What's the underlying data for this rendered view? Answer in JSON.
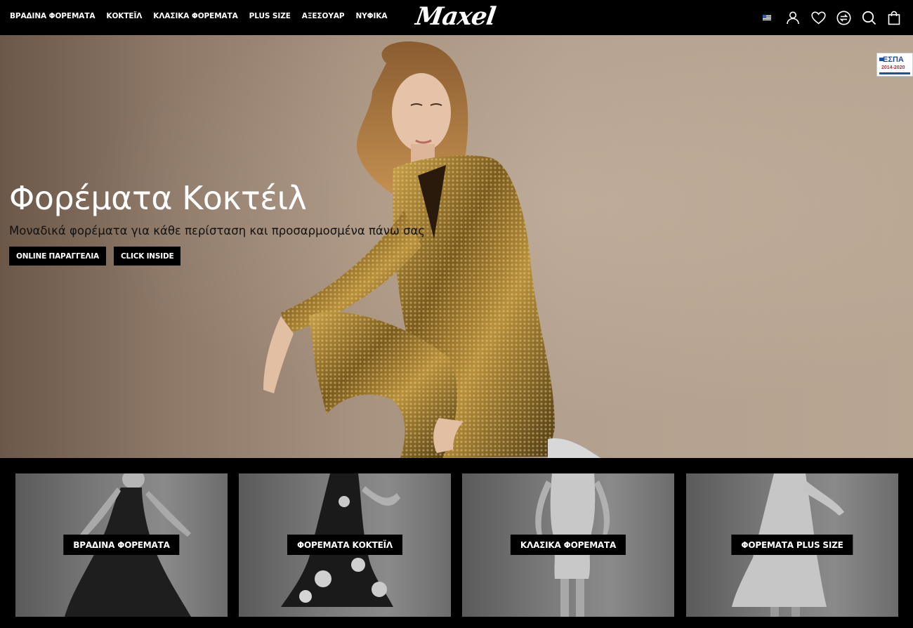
{
  "header": {
    "nav": [
      {
        "label": "ΒΡΑΔΙΝΑ ΦΟΡΕΜΑΤΑ"
      },
      {
        "label": "ΚΟΚΤΕΪΛ"
      },
      {
        "label": "ΚΛΑΣΙΚΑ ΦΟΡΕΜΑΤΑ"
      },
      {
        "label": "PLUS SIZE"
      },
      {
        "label": "ΑΞΕΣΟΥΑΡ"
      },
      {
        "label": "ΝΥΦΙΚΑ"
      }
    ],
    "logo": "Maxel",
    "icons": [
      "greek-flag-icon",
      "user-icon",
      "heart-icon",
      "compare-icon",
      "search-icon",
      "shopping-bag-icon"
    ]
  },
  "hero": {
    "title": "Φορέματα Κοκτέιλ",
    "subtitle": "Μοναδικά φορέματα για κάθε περίσταση και προσαρμοσμένα πάνω σας",
    "buttons": [
      {
        "label": "ONLINE ΠΑΡΑΓΓΕΛΙΑ"
      },
      {
        "label": "CLICK INSIDE"
      }
    ],
    "badge": {
      "title": "ΕΣΠΑ",
      "years": "2014-2020"
    }
  },
  "categories": [
    {
      "label": "ΒΡΑΔΙΝΑ ΦΟΡΕΜΑΤΑ"
    },
    {
      "label": "ΦΟΡΕΜΑΤΑ ΚΟΚΤΕΪΛ"
    },
    {
      "label": "ΚΛΑΣΙΚΑ ΦΟΡΕΜΑΤΑ"
    },
    {
      "label": "ΦΟΡΕΜΑΤΑ PLUS SIZE"
    }
  ],
  "colors": {
    "background": "#000000",
    "hero_bg": "#b4a08e",
    "dress_gold": "#8a6a2a",
    "espa_blue": "#1f4fa3",
    "espa_red": "#c0262d"
  }
}
